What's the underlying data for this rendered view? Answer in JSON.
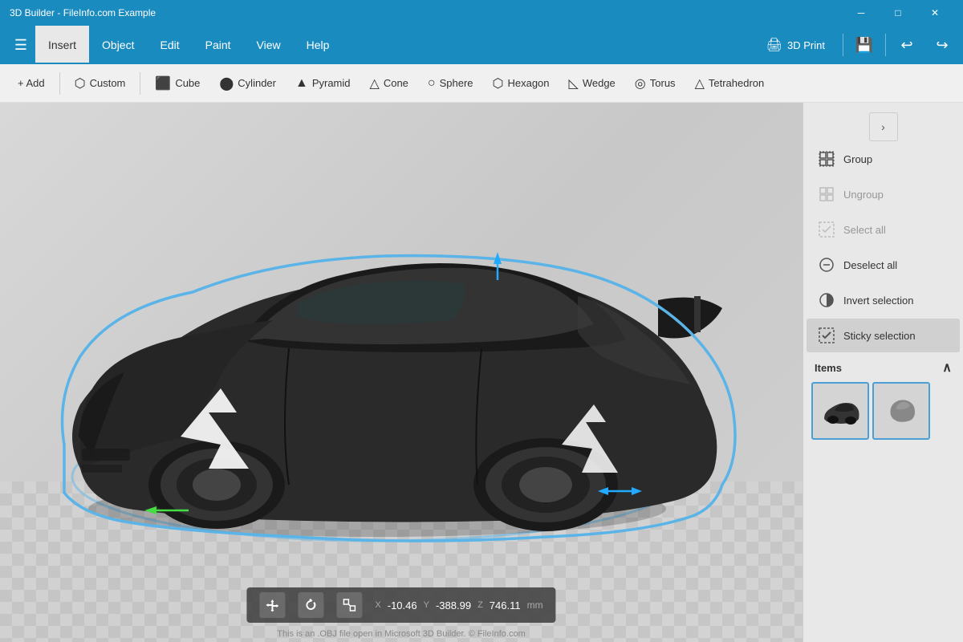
{
  "titlebar": {
    "title": "3D Builder - FileInfo.com Example",
    "minimize": "─",
    "maximize": "□",
    "close": "✕"
  },
  "menubar": {
    "tabs": [
      "Insert",
      "Object",
      "Edit",
      "Paint",
      "View",
      "Help"
    ],
    "active_tab": "Insert",
    "print_label": "3D Print",
    "undo_icon": "↩",
    "redo_icon": "↪"
  },
  "toolbar": {
    "add_label": "+ Add",
    "custom_label": "Custom",
    "cube_label": "Cube",
    "cylinder_label": "Cylinder",
    "pyramid_label": "Pyramid",
    "cone_label": "Cone",
    "sphere_label": "Sphere",
    "hexagon_label": "Hexagon",
    "wedge_label": "Wedge",
    "torus_label": "Torus",
    "tetrahedron_label": "Tetrahedron"
  },
  "right_panel": {
    "group_label": "Group",
    "ungroup_label": "Ungroup",
    "select_all_label": "Select all",
    "deselect_all_label": "Deselect all",
    "invert_selection_label": "Invert selection",
    "sticky_selection_label": "Sticky selection",
    "items_label": "Items",
    "collapse_icon": "›"
  },
  "statusbar": {
    "x_label": "X",
    "y_label": "Y",
    "z_label": "Z",
    "x_val": "-10.46",
    "y_val": "-388.99",
    "z_val": "746.11",
    "unit": "mm"
  },
  "bottom_text": "This is an .OBJ file open in Microsoft 3D Builder. © FileInfo.com"
}
